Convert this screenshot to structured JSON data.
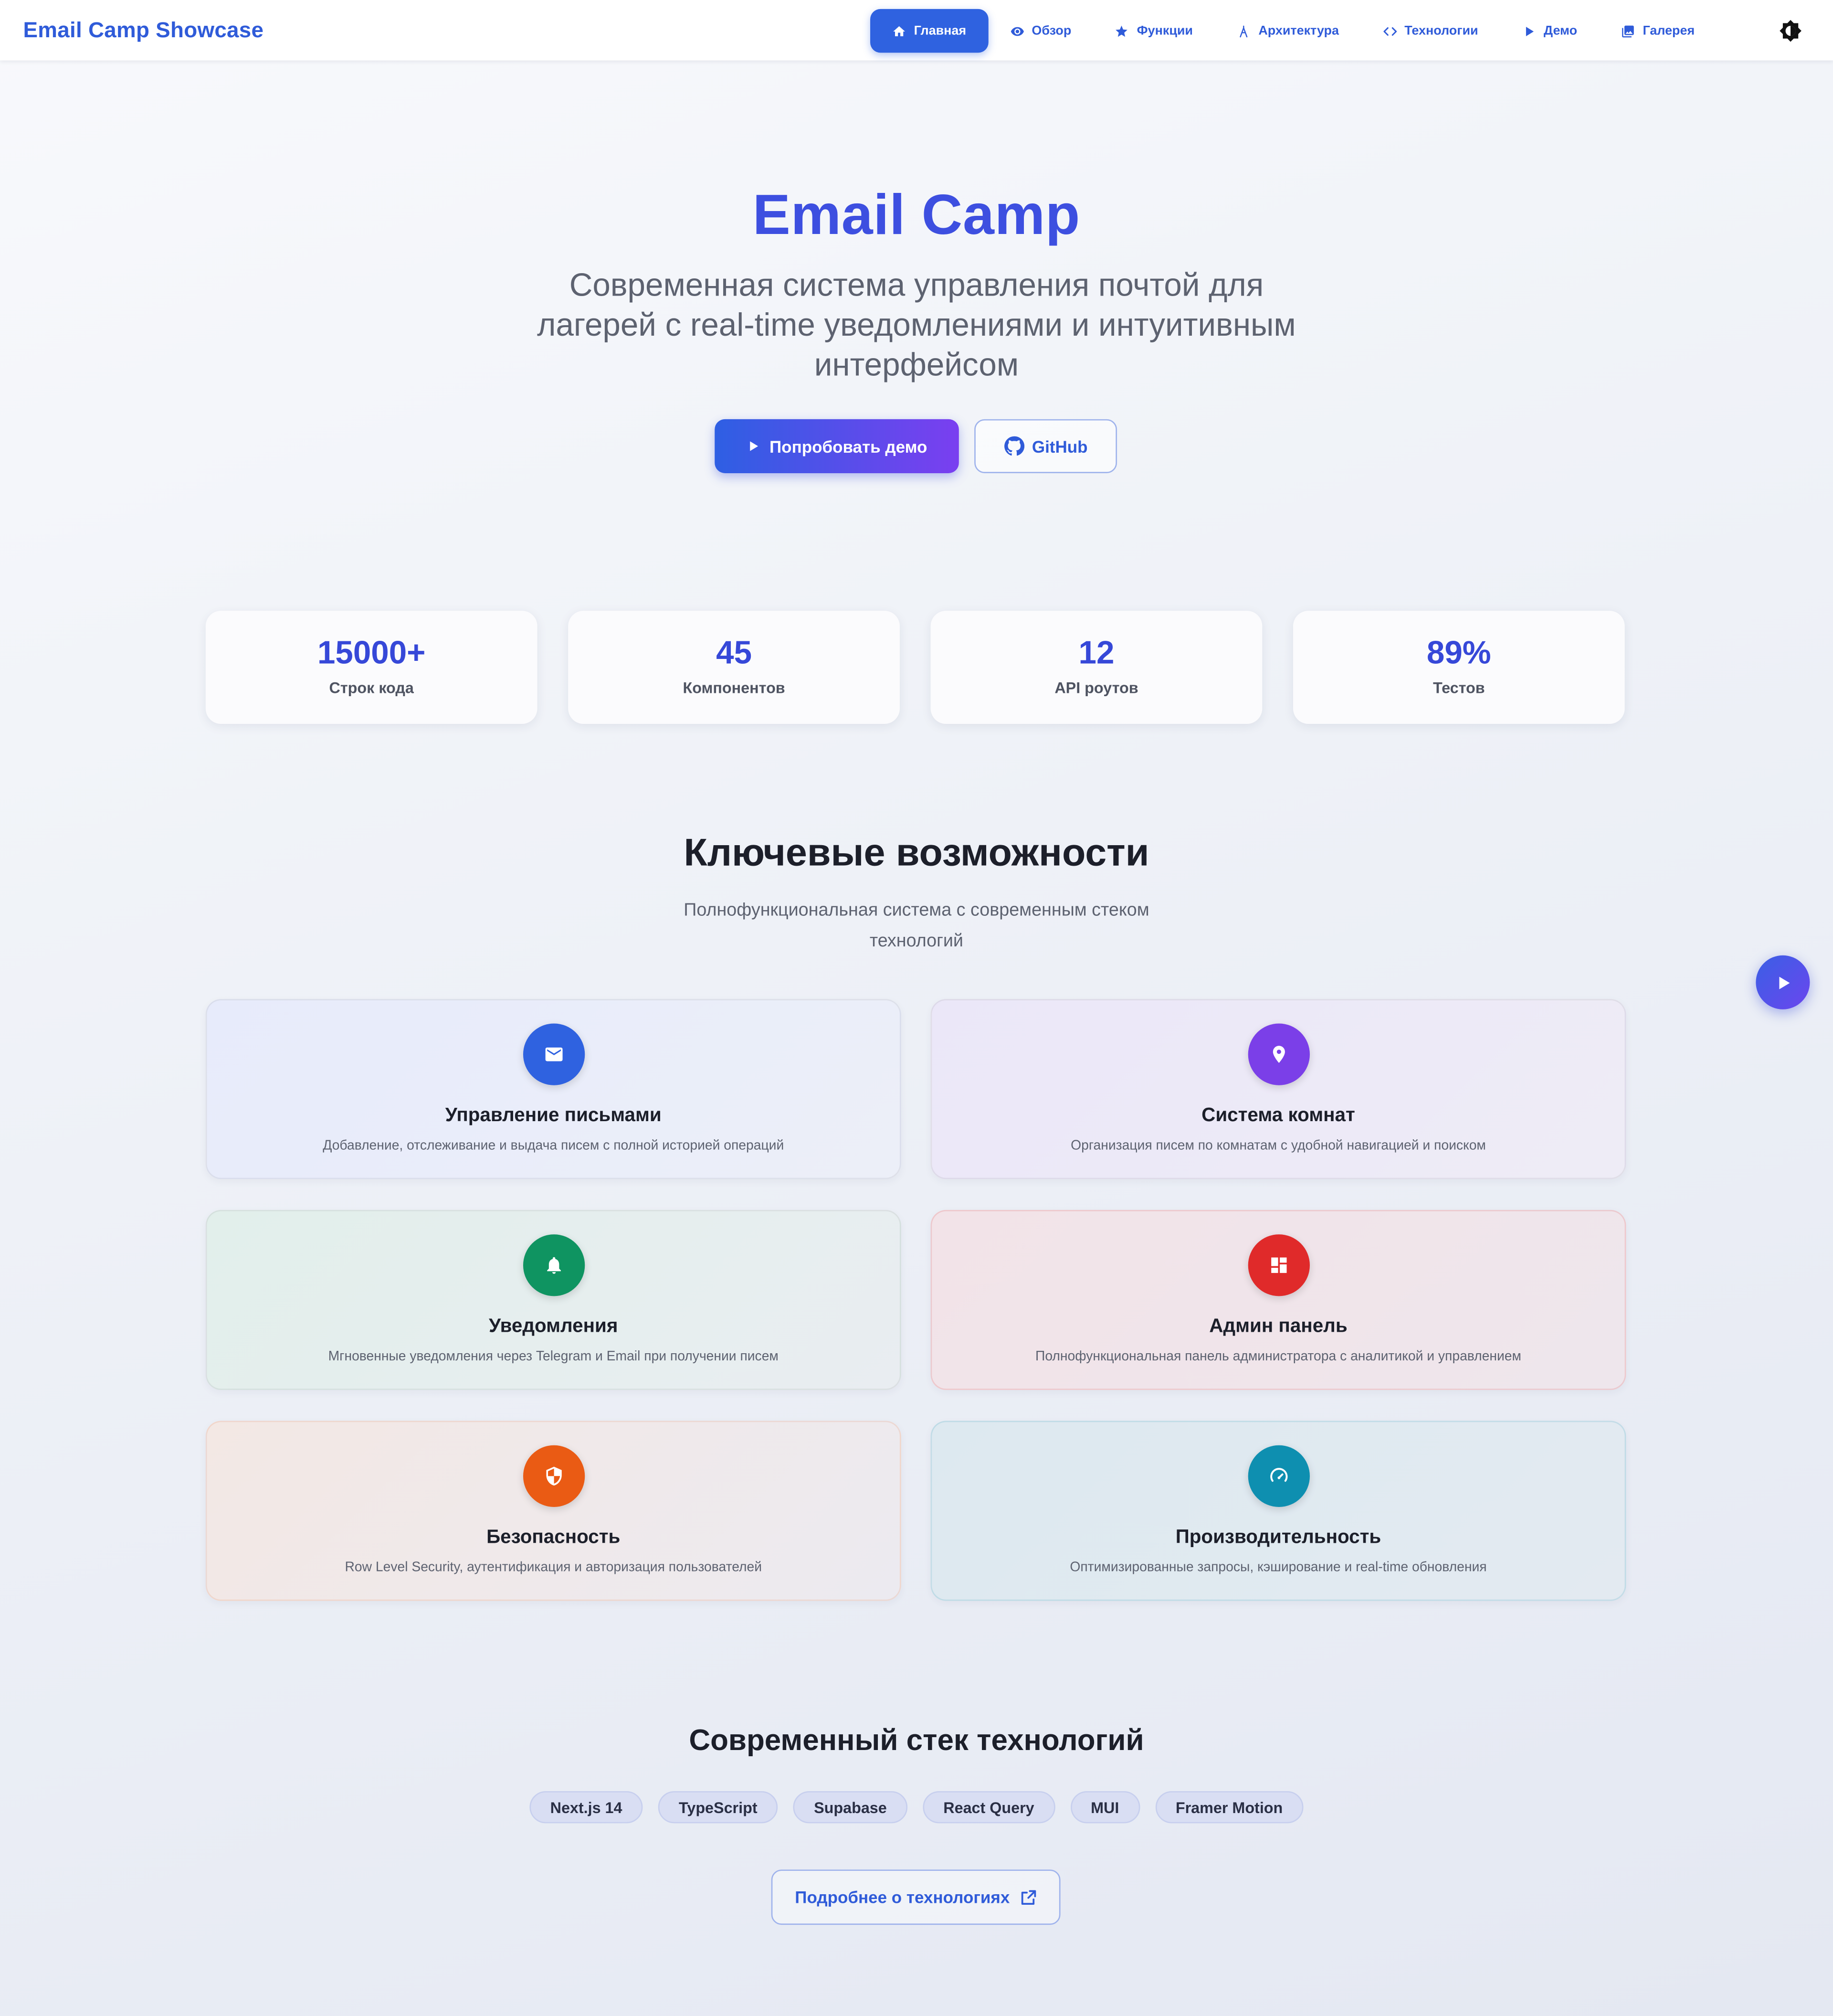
{
  "brand": "Email Camp Showcase",
  "nav": {
    "items": [
      {
        "label": "Главная",
        "icon": "home-icon",
        "active": true
      },
      {
        "label": "Обзор",
        "icon": "eye-icon"
      },
      {
        "label": "Функции",
        "icon": "star-icon"
      },
      {
        "label": "Архитектура",
        "icon": "architecture-icon"
      },
      {
        "label": "Технологии",
        "icon": "code-icon"
      },
      {
        "label": "Демо",
        "icon": "play-icon"
      },
      {
        "label": "Галерея",
        "icon": "gallery-icon"
      }
    ],
    "theme_toggle_icon": "theme-toggle-icon"
  },
  "hero": {
    "title": "Email Camp",
    "subtitle": "Современная система управления почтой для лагерей с real-time уведомлениями и интуитивным интерфейсом",
    "demo_button": "Попробовать демо",
    "github_button": "GitHub"
  },
  "stats": [
    {
      "value": "15000+",
      "label": "Строк кода"
    },
    {
      "value": "45",
      "label": "Компонентов"
    },
    {
      "value": "12",
      "label": "API роутов"
    },
    {
      "value": "89%",
      "label": "Тестов"
    }
  ],
  "features": {
    "title": "Ключевые возможности",
    "subtitle": "Полнофункциональная система с современным стеком технологий",
    "cards": [
      {
        "title": "Управление письмами",
        "desc": "Добавление, отслеживание и выдача писем с полной историей операций",
        "icon": "mail-icon",
        "color": "#2f62e0"
      },
      {
        "title": "Система комнат",
        "desc": "Организация писем по комнатам с удобной навигацией и поиском",
        "icon": "location-pin-icon",
        "color": "#7b3fe8"
      },
      {
        "title": "Уведомления",
        "desc": "Мгновенные уведомления через Telegram и Email при получении писем",
        "icon": "bell-icon",
        "color": "#0f9461"
      },
      {
        "title": "Админ панель",
        "desc": "Полнофункциональная панель администратора с аналитикой и управлением",
        "icon": "dashboard-icon",
        "color": "#e02a2a"
      },
      {
        "title": "Безопасность",
        "desc": "Row Level Security, аутентификация и авторизация пользователей",
        "icon": "shield-icon",
        "color": "#ea5b14"
      },
      {
        "title": "Производительность",
        "desc": "Оптимизированные запросы, кэширование и real-time обновления",
        "icon": "speedometer-icon",
        "color": "#0e8fb0"
      }
    ]
  },
  "tech": {
    "title": "Современный стек технологий",
    "chips": [
      "Next.js 14",
      "TypeScript",
      "Supabase",
      "React Query",
      "MUI",
      "Framer Motion"
    ],
    "more_button": "Подробнее о технологиях"
  },
  "fab_icon": "play-icon"
}
